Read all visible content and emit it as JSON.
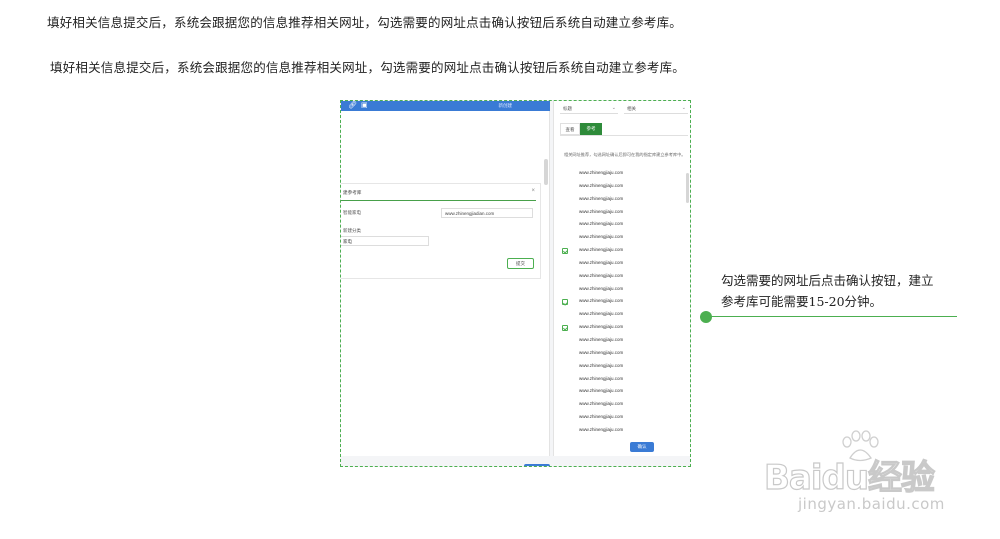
{
  "intro": {
    "line1": "填好相关信息提交后，系统会跟据您的信息推荐相关网址，勾选需要的网址点击确认按钮后系统自动建立参考库。",
    "line2": "填好相关信息提交后，系统会跟据您的信息推荐相关网址，勾选需要的网址点击确认按钮后系统自动建立参考库。"
  },
  "screenshot": {
    "left_panel": {
      "toolbar_icons": [
        "link-icon",
        "image-icon"
      ],
      "toolbar_label": "新创建",
      "dialog": {
        "title": "建参考库",
        "close": "×",
        "field1_label": "智能家电",
        "url_value": "www.zhinengjiadian.com",
        "field2_label": "新建分类",
        "field2_value": "家电",
        "submit": "提交"
      }
    },
    "right_panel": {
      "select1": "标题",
      "select2": "相关",
      "tabs": [
        "查看",
        "参考"
      ],
      "note": "相关网址推荐，勾选网址确认后即可在我的指定库建立参考库中。",
      "list": [
        {
          "url": "www.zhinengjiaju.com",
          "checked": false
        },
        {
          "url": "www.zhinengjiaju.com",
          "checked": false
        },
        {
          "url": "www.zhinengjiaju.com",
          "checked": false
        },
        {
          "url": "www.zhinengjiaju.com",
          "checked": false
        },
        {
          "url": "www.zhinengjiaju.com",
          "checked": false
        },
        {
          "url": "www.zhinengjiaju.com",
          "checked": false
        },
        {
          "url": "www.zhinengjiaju.com",
          "checked": true
        },
        {
          "url": "www.zhinengjiaju.com",
          "checked": false
        },
        {
          "url": "www.zhinengjiaju.com",
          "checked": false
        },
        {
          "url": "www.zhinengjiaju.com",
          "checked": false
        },
        {
          "url": "www.zhinengjiaju.com",
          "checked": true
        },
        {
          "url": "www.zhinengjiaju.com",
          "checked": false
        },
        {
          "url": "www.zhinengjiaju.com",
          "checked": true
        },
        {
          "url": "www.zhinengjiaju.com",
          "checked": false
        },
        {
          "url": "www.zhinengjiaju.com",
          "checked": false
        },
        {
          "url": "www.zhinengjiaju.com",
          "checked": false
        },
        {
          "url": "www.zhinengjiaju.com",
          "checked": false
        },
        {
          "url": "www.zhinengjiaju.com",
          "checked": false
        },
        {
          "url": "www.zhinengjiaju.com",
          "checked": false
        },
        {
          "url": "www.zhinengjiaju.com",
          "checked": false
        },
        {
          "url": "www.zhinengjiaju.com",
          "checked": false
        }
      ],
      "confirm": "确认"
    }
  },
  "callout": {
    "line1": "勾选需要的网址后点击确认按钮，建立",
    "line2": "参考库可能需要15-20分钟。"
  },
  "watermark": {
    "logo": "Baidu经验",
    "url": "jingyan.baidu.com"
  },
  "colors": {
    "accent_green": "#4caf50",
    "tab_green": "#2e8b3a",
    "toolbar_blue": "#3a7bd5"
  }
}
